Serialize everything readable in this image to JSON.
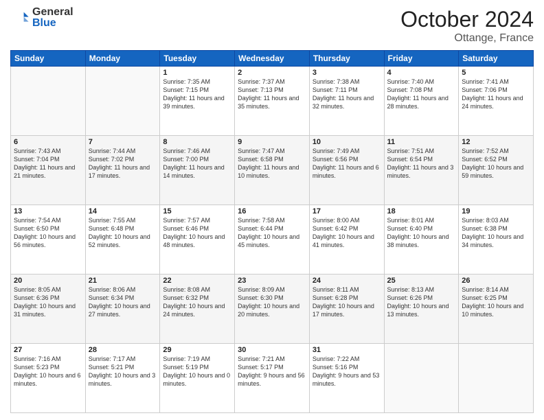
{
  "header": {
    "logo_general": "General",
    "logo_blue": "Blue",
    "month": "October 2024",
    "location": "Ottange, France"
  },
  "days_of_week": [
    "Sunday",
    "Monday",
    "Tuesday",
    "Wednesday",
    "Thursday",
    "Friday",
    "Saturday"
  ],
  "weeks": [
    [
      {
        "day": "",
        "sunrise": "",
        "sunset": "",
        "daylight": ""
      },
      {
        "day": "",
        "sunrise": "",
        "sunset": "",
        "daylight": ""
      },
      {
        "day": "1",
        "sunrise": "Sunrise: 7:35 AM",
        "sunset": "Sunset: 7:15 PM",
        "daylight": "Daylight: 11 hours and 39 minutes."
      },
      {
        "day": "2",
        "sunrise": "Sunrise: 7:37 AM",
        "sunset": "Sunset: 7:13 PM",
        "daylight": "Daylight: 11 hours and 35 minutes."
      },
      {
        "day": "3",
        "sunrise": "Sunrise: 7:38 AM",
        "sunset": "Sunset: 7:11 PM",
        "daylight": "Daylight: 11 hours and 32 minutes."
      },
      {
        "day": "4",
        "sunrise": "Sunrise: 7:40 AM",
        "sunset": "Sunset: 7:08 PM",
        "daylight": "Daylight: 11 hours and 28 minutes."
      },
      {
        "day": "5",
        "sunrise": "Sunrise: 7:41 AM",
        "sunset": "Sunset: 7:06 PM",
        "daylight": "Daylight: 11 hours and 24 minutes."
      }
    ],
    [
      {
        "day": "6",
        "sunrise": "Sunrise: 7:43 AM",
        "sunset": "Sunset: 7:04 PM",
        "daylight": "Daylight: 11 hours and 21 minutes."
      },
      {
        "day": "7",
        "sunrise": "Sunrise: 7:44 AM",
        "sunset": "Sunset: 7:02 PM",
        "daylight": "Daylight: 11 hours and 17 minutes."
      },
      {
        "day": "8",
        "sunrise": "Sunrise: 7:46 AM",
        "sunset": "Sunset: 7:00 PM",
        "daylight": "Daylight: 11 hours and 14 minutes."
      },
      {
        "day": "9",
        "sunrise": "Sunrise: 7:47 AM",
        "sunset": "Sunset: 6:58 PM",
        "daylight": "Daylight: 11 hours and 10 minutes."
      },
      {
        "day": "10",
        "sunrise": "Sunrise: 7:49 AM",
        "sunset": "Sunset: 6:56 PM",
        "daylight": "Daylight: 11 hours and 6 minutes."
      },
      {
        "day": "11",
        "sunrise": "Sunrise: 7:51 AM",
        "sunset": "Sunset: 6:54 PM",
        "daylight": "Daylight: 11 hours and 3 minutes."
      },
      {
        "day": "12",
        "sunrise": "Sunrise: 7:52 AM",
        "sunset": "Sunset: 6:52 PM",
        "daylight": "Daylight: 10 hours and 59 minutes."
      }
    ],
    [
      {
        "day": "13",
        "sunrise": "Sunrise: 7:54 AM",
        "sunset": "Sunset: 6:50 PM",
        "daylight": "Daylight: 10 hours and 56 minutes."
      },
      {
        "day": "14",
        "sunrise": "Sunrise: 7:55 AM",
        "sunset": "Sunset: 6:48 PM",
        "daylight": "Daylight: 10 hours and 52 minutes."
      },
      {
        "day": "15",
        "sunrise": "Sunrise: 7:57 AM",
        "sunset": "Sunset: 6:46 PM",
        "daylight": "Daylight: 10 hours and 48 minutes."
      },
      {
        "day": "16",
        "sunrise": "Sunrise: 7:58 AM",
        "sunset": "Sunset: 6:44 PM",
        "daylight": "Daylight: 10 hours and 45 minutes."
      },
      {
        "day": "17",
        "sunrise": "Sunrise: 8:00 AM",
        "sunset": "Sunset: 6:42 PM",
        "daylight": "Daylight: 10 hours and 41 minutes."
      },
      {
        "day": "18",
        "sunrise": "Sunrise: 8:01 AM",
        "sunset": "Sunset: 6:40 PM",
        "daylight": "Daylight: 10 hours and 38 minutes."
      },
      {
        "day": "19",
        "sunrise": "Sunrise: 8:03 AM",
        "sunset": "Sunset: 6:38 PM",
        "daylight": "Daylight: 10 hours and 34 minutes."
      }
    ],
    [
      {
        "day": "20",
        "sunrise": "Sunrise: 8:05 AM",
        "sunset": "Sunset: 6:36 PM",
        "daylight": "Daylight: 10 hours and 31 minutes."
      },
      {
        "day": "21",
        "sunrise": "Sunrise: 8:06 AM",
        "sunset": "Sunset: 6:34 PM",
        "daylight": "Daylight: 10 hours and 27 minutes."
      },
      {
        "day": "22",
        "sunrise": "Sunrise: 8:08 AM",
        "sunset": "Sunset: 6:32 PM",
        "daylight": "Daylight: 10 hours and 24 minutes."
      },
      {
        "day": "23",
        "sunrise": "Sunrise: 8:09 AM",
        "sunset": "Sunset: 6:30 PM",
        "daylight": "Daylight: 10 hours and 20 minutes."
      },
      {
        "day": "24",
        "sunrise": "Sunrise: 8:11 AM",
        "sunset": "Sunset: 6:28 PM",
        "daylight": "Daylight: 10 hours and 17 minutes."
      },
      {
        "day": "25",
        "sunrise": "Sunrise: 8:13 AM",
        "sunset": "Sunset: 6:26 PM",
        "daylight": "Daylight: 10 hours and 13 minutes."
      },
      {
        "day": "26",
        "sunrise": "Sunrise: 8:14 AM",
        "sunset": "Sunset: 6:25 PM",
        "daylight": "Daylight: 10 hours and 10 minutes."
      }
    ],
    [
      {
        "day": "27",
        "sunrise": "Sunrise: 7:16 AM",
        "sunset": "Sunset: 5:23 PM",
        "daylight": "Daylight: 10 hours and 6 minutes."
      },
      {
        "day": "28",
        "sunrise": "Sunrise: 7:17 AM",
        "sunset": "Sunset: 5:21 PM",
        "daylight": "Daylight: 10 hours and 3 minutes."
      },
      {
        "day": "29",
        "sunrise": "Sunrise: 7:19 AM",
        "sunset": "Sunset: 5:19 PM",
        "daylight": "Daylight: 10 hours and 0 minutes."
      },
      {
        "day": "30",
        "sunrise": "Sunrise: 7:21 AM",
        "sunset": "Sunset: 5:17 PM",
        "daylight": "Daylight: 9 hours and 56 minutes."
      },
      {
        "day": "31",
        "sunrise": "Sunrise: 7:22 AM",
        "sunset": "Sunset: 5:16 PM",
        "daylight": "Daylight: 9 hours and 53 minutes."
      },
      {
        "day": "",
        "sunrise": "",
        "sunset": "",
        "daylight": ""
      },
      {
        "day": "",
        "sunrise": "",
        "sunset": "",
        "daylight": ""
      }
    ]
  ]
}
